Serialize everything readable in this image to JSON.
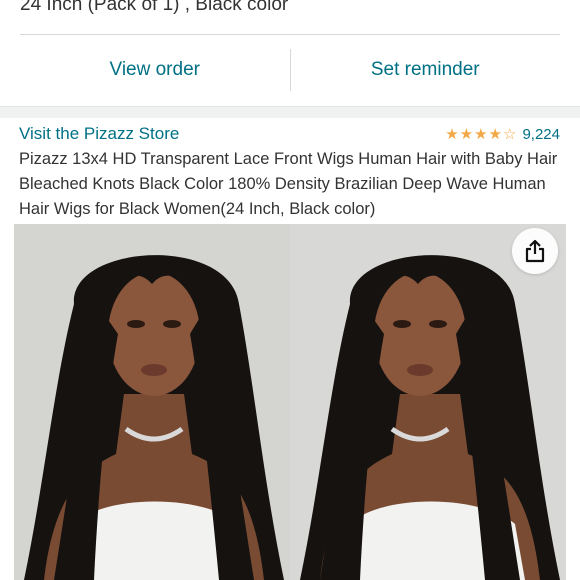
{
  "order": {
    "variant_text": "24 Inch (Pack of 1) , Black color",
    "view_order_label": "View order",
    "set_reminder_label": "Set reminder"
  },
  "product": {
    "store_link": "Visit the Pizazz Store",
    "rating_value": 4.5,
    "rating_count": "9,224",
    "title": "Pizazz 13x4 HD Transparent Lace Front Wigs Human Hair with Baby Hair Bleached Knots Black Color 180% Density Brazilian Deep Wave Human Hair Wigs for Black Women(24 Inch, Black color)"
  },
  "icons": {
    "star": "star-icon",
    "share": "share-icon"
  },
  "colors": {
    "link": "#007185",
    "star": "#f3a847",
    "text": "#333333",
    "divider": "#d5d9d9"
  }
}
